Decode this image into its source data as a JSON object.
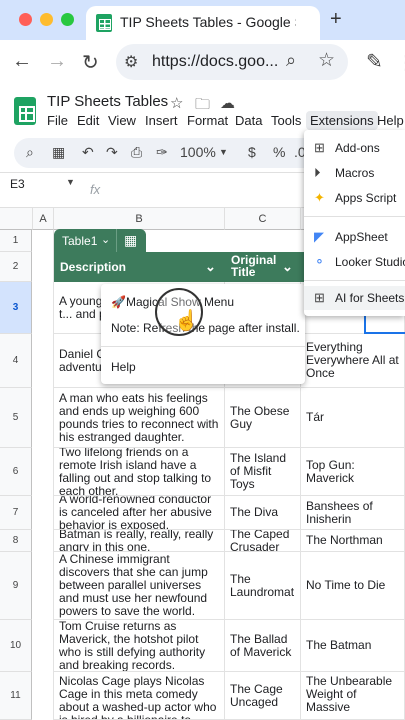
{
  "browser": {
    "tab_title": "TIP Sheets Tables - Google Sheets",
    "url": "https://docs.goo...",
    "new_tab_glyph": "+",
    "close_tab_glyph": "×"
  },
  "sheet": {
    "title": "TIP Sheets Tables",
    "menu": [
      "File",
      "Edit",
      "View",
      "Insert",
      "Format",
      "Data",
      "Tools",
      "Extensions",
      "Help"
    ],
    "toolbar": {
      "zoom": "100%",
      "currency": "$",
      "percent": "%",
      "decimal": ".0"
    },
    "name_box": "E3",
    "fx": "fx",
    "columns": [
      "A",
      "B",
      "C"
    ],
    "table_name": "Table1",
    "headers": {
      "description": "Description",
      "original_title": "Original Title"
    },
    "rows": [
      {
        "num": "1",
        "desc": "",
        "orig": "",
        "new": ""
      },
      {
        "num": "2",
        "desc": "",
        "orig": "",
        "new": ""
      },
      {
        "num": "3",
        "desc": "A young ... dangero... protect t... and peop...",
        "orig": "",
        "new": ""
      },
      {
        "num": "4",
        "desc": "Daniel C... James B... adventu... off agai...",
        "orig": "",
        "new": "Everything Everywhere All at Once"
      },
      {
        "num": "5",
        "desc": "A man who eats his feelings and ends up weighing 600 pounds tries to reconnect with his estranged daughter.",
        "orig": "The Obese Guy",
        "new": "Tár"
      },
      {
        "num": "6",
        "desc": "Two lifelong friends on a remote Irish island have a falling out and stop talking to each other.",
        "orig": "The Island of Misfit Toys",
        "new": "Top Gun: Maverick"
      },
      {
        "num": "7",
        "desc": "A world-renowned conductor is canceled after her abusive behavior is exposed.",
        "orig": "The Diva",
        "new": "Banshees of Inisherin"
      },
      {
        "num": "8",
        "desc": "Batman is really, really, really angry in this one.",
        "orig": "The Caped Crusader",
        "new": "The Northman"
      },
      {
        "num": "9",
        "desc": "A Chinese immigrant discovers that she can jump between parallel universes and must use her newfound powers to save the world.",
        "orig": "The Laundromat",
        "new": "No Time to Die"
      },
      {
        "num": "10",
        "desc": "Tom Cruise returns as Maverick, the hotshot pilot who is still defying authority and breaking records.",
        "orig": "The Ballad of Maverick",
        "new": "The Batman"
      },
      {
        "num": "11",
        "desc": "Nicolas Cage plays Nicolas Cage in this meta comedy about a washed-up actor who is hired by a billionaire to attend his birthday",
        "orig": "The Cage Uncaged",
        "new": "The Unbearable Weight of Massive"
      }
    ]
  },
  "popup_menu": {
    "item1": "🚀Magical Show Menu",
    "item2": "Note: Refresh the page after install.",
    "item3": "Help"
  },
  "extensions_menu": {
    "items": [
      "Add-ons",
      "Macros",
      "Apps Script",
      "AppSheet",
      "Looker Studio",
      "AI for Sheets™"
    ]
  }
}
